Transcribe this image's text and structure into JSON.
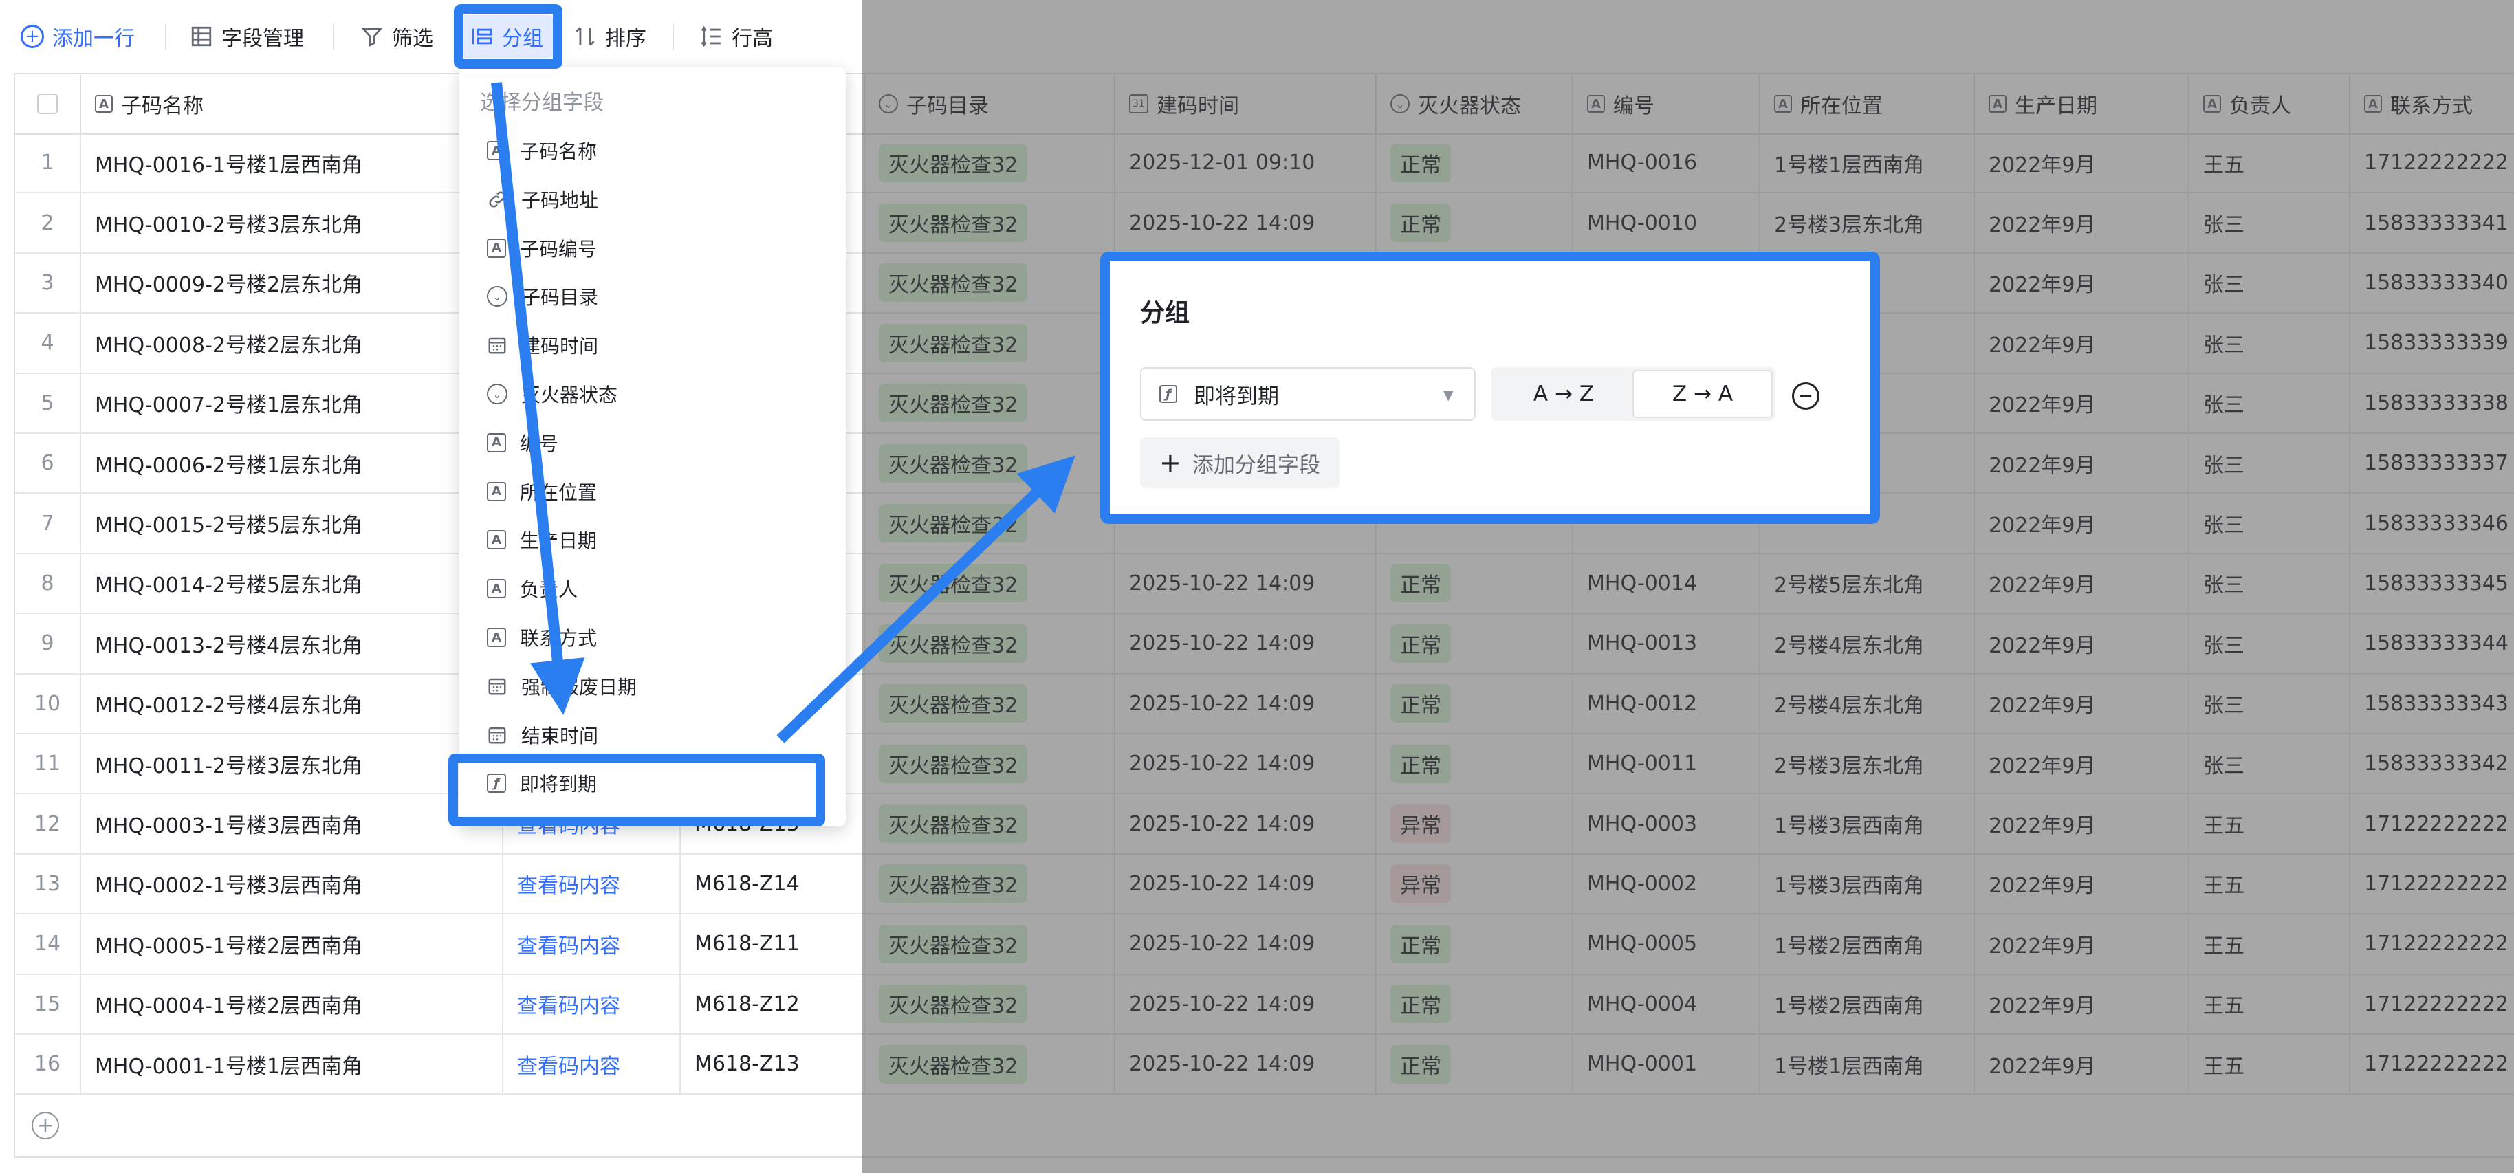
{
  "toolbar": {
    "add_row": "添加一行",
    "field_manage": "字段管理",
    "filter": "筛选",
    "group": "分组",
    "sort": "排序",
    "row_height": "行高"
  },
  "columns": [
    "子码名称",
    "",
    "",
    "子码目录",
    "建码时间",
    "灭火器状态",
    "编号",
    "所在位置",
    "生产日期",
    "负责人",
    "联系方式"
  ],
  "rows": [
    {
      "idx": "1",
      "name": "MHQ-0016-1号楼1层西南角",
      "link": "",
      "code": "",
      "dir": "灭火器检查32",
      "time": "2025-12-01 09:10",
      "status": "正常",
      "num": "MHQ-0016",
      "loc": "1号楼1层西南角",
      "date": "2022年9月",
      "owner": "王五",
      "phone": "17122222222"
    },
    {
      "idx": "2",
      "name": "MHQ-0010-2号楼3层东北角",
      "link": "",
      "code": "",
      "dir": "灭火器检查32",
      "time": "2025-10-22 14:09",
      "status": "正常",
      "num": "MHQ-0010",
      "loc": "2号楼3层东北角",
      "date": "2022年9月",
      "owner": "张三",
      "phone": "15833333341"
    },
    {
      "idx": "3",
      "name": "MHQ-0009-2号楼2层东北角",
      "link": "",
      "code": "",
      "dir": "灭火器检查32",
      "time": "",
      "status": "",
      "num": "",
      "loc": "角",
      "date": "2022年9月",
      "owner": "张三",
      "phone": "15833333340"
    },
    {
      "idx": "4",
      "name": "MHQ-0008-2号楼2层东北角",
      "link": "",
      "code": "",
      "dir": "灭火器检查32",
      "time": "",
      "status": "",
      "num": "",
      "loc": "角",
      "date": "2022年9月",
      "owner": "张三",
      "phone": "15833333339"
    },
    {
      "idx": "5",
      "name": "MHQ-0007-2号楼1层东北角",
      "link": "",
      "code": "",
      "dir": "灭火器检查32",
      "time": "",
      "status": "",
      "num": "",
      "loc": "角",
      "date": "2022年9月",
      "owner": "张三",
      "phone": "15833333338"
    },
    {
      "idx": "6",
      "name": "MHQ-0006-2号楼1层东北角",
      "link": "",
      "code": "",
      "dir": "灭火器检查32",
      "time": "",
      "status": "",
      "num": "",
      "loc": "角",
      "date": "2022年9月",
      "owner": "张三",
      "phone": "15833333337"
    },
    {
      "idx": "7",
      "name": "MHQ-0015-2号楼5层东北角",
      "link": "",
      "code": "",
      "dir": "灭火器检查32",
      "time": "",
      "status": "",
      "num": "",
      "loc": "",
      "date": "2022年9月",
      "owner": "张三",
      "phone": "15833333346"
    },
    {
      "idx": "8",
      "name": "MHQ-0014-2号楼5层东北角",
      "link": "",
      "code": "",
      "dir": "灭火器检查32",
      "time": "2025-10-22 14:09",
      "status": "正常",
      "num": "MHQ-0014",
      "loc": "2号楼5层东北角",
      "date": "2022年9月",
      "owner": "张三",
      "phone": "15833333345"
    },
    {
      "idx": "9",
      "name": "MHQ-0013-2号楼4层东北角",
      "link": "",
      "code": "",
      "dir": "灭火器检查32",
      "time": "2025-10-22 14:09",
      "status": "正常",
      "num": "MHQ-0013",
      "loc": "2号楼4层东北角",
      "date": "2022年9月",
      "owner": "张三",
      "phone": "15833333344"
    },
    {
      "idx": "10",
      "name": "MHQ-0012-2号楼4层东北角",
      "link": "",
      "code": "",
      "dir": "灭火器检查32",
      "time": "2025-10-22 14:09",
      "status": "正常",
      "num": "MHQ-0012",
      "loc": "2号楼4层东北角",
      "date": "2022年9月",
      "owner": "张三",
      "phone": "15833333343"
    },
    {
      "idx": "11",
      "name": "MHQ-0011-2号楼3层东北角",
      "link": "",
      "code": "",
      "dir": "灭火器检查32",
      "time": "2025-10-22 14:09",
      "status": "正常",
      "num": "MHQ-0011",
      "loc": "2号楼3层东北角",
      "date": "2022年9月",
      "owner": "张三",
      "phone": "15833333342"
    },
    {
      "idx": "12",
      "name": "MHQ-0003-1号楼3层西南角",
      "link": "查看码内容",
      "code": "M618-Z15",
      "dir": "灭火器检查32",
      "time": "2025-10-22 14:09",
      "status": "异常",
      "num": "MHQ-0003",
      "loc": "1号楼3层西南角",
      "date": "2022年9月",
      "owner": "王五",
      "phone": "17122222222"
    },
    {
      "idx": "13",
      "name": "MHQ-0002-1号楼3层西南角",
      "link": "查看码内容",
      "code": "M618-Z14",
      "dir": "灭火器检查32",
      "time": "2025-10-22 14:09",
      "status": "异常",
      "num": "MHQ-0002",
      "loc": "1号楼3层西南角",
      "date": "2022年9月",
      "owner": "王五",
      "phone": "17122222222"
    },
    {
      "idx": "14",
      "name": "MHQ-0005-1号楼2层西南角",
      "link": "查看码内容",
      "code": "M618-Z11",
      "dir": "灭火器检查32",
      "time": "2025-10-22 14:09",
      "status": "正常",
      "num": "MHQ-0005",
      "loc": "1号楼2层西南角",
      "date": "2022年9月",
      "owner": "王五",
      "phone": "17122222222"
    },
    {
      "idx": "15",
      "name": "MHQ-0004-1号楼2层西南角",
      "link": "查看码内容",
      "code": "M618-Z12",
      "dir": "灭火器检查32",
      "time": "2025-10-22 14:09",
      "status": "正常",
      "num": "MHQ-0004",
      "loc": "1号楼2层西南角",
      "date": "2022年9月",
      "owner": "王五",
      "phone": "17122222222"
    },
    {
      "idx": "16",
      "name": "MHQ-0001-1号楼1层西南角",
      "link": "查看码内容",
      "code": "M618-Z13",
      "dir": "灭火器检查32",
      "time": "2025-10-22 14:09",
      "status": "正常",
      "num": "MHQ-0001",
      "loc": "1号楼1层西南角",
      "date": "2022年9月",
      "owner": "王五",
      "phone": "17122222222"
    }
  ],
  "menu": {
    "title": "选择分组字段",
    "items": [
      {
        "label": "子码名称",
        "icon": "text-icon"
      },
      {
        "label": "子码地址",
        "icon": "link-icon"
      },
      {
        "label": "子码编号",
        "icon": "text-icon"
      },
      {
        "label": "子码目录",
        "icon": "select-icon"
      },
      {
        "label": "建码时间",
        "icon": "calendar-icon"
      },
      {
        "label": "灭火器状态",
        "icon": "select-icon"
      },
      {
        "label": "编号",
        "icon": "text-icon"
      },
      {
        "label": "所在位置",
        "icon": "text-icon"
      },
      {
        "label": "生产日期",
        "icon": "text-icon"
      },
      {
        "label": "负责人",
        "icon": "text-icon"
      },
      {
        "label": "联系方式",
        "icon": "text-icon"
      },
      {
        "label": "强制报废日期",
        "icon": "calendar-icon"
      },
      {
        "label": "结束时间",
        "icon": "calendar-icon"
      },
      {
        "label": "即将到期",
        "icon": "formula-icon"
      }
    ]
  },
  "popup": {
    "title": "分组",
    "field": "即将到期",
    "asc": "A → Z",
    "desc": "Z → A",
    "add_field": "添加分组字段"
  },
  "colors": {
    "accent": "#3370ff",
    "highlight": "#2b7ef0",
    "tag_green": "#d9f5d6",
    "tag_red": "#fde2e2"
  }
}
